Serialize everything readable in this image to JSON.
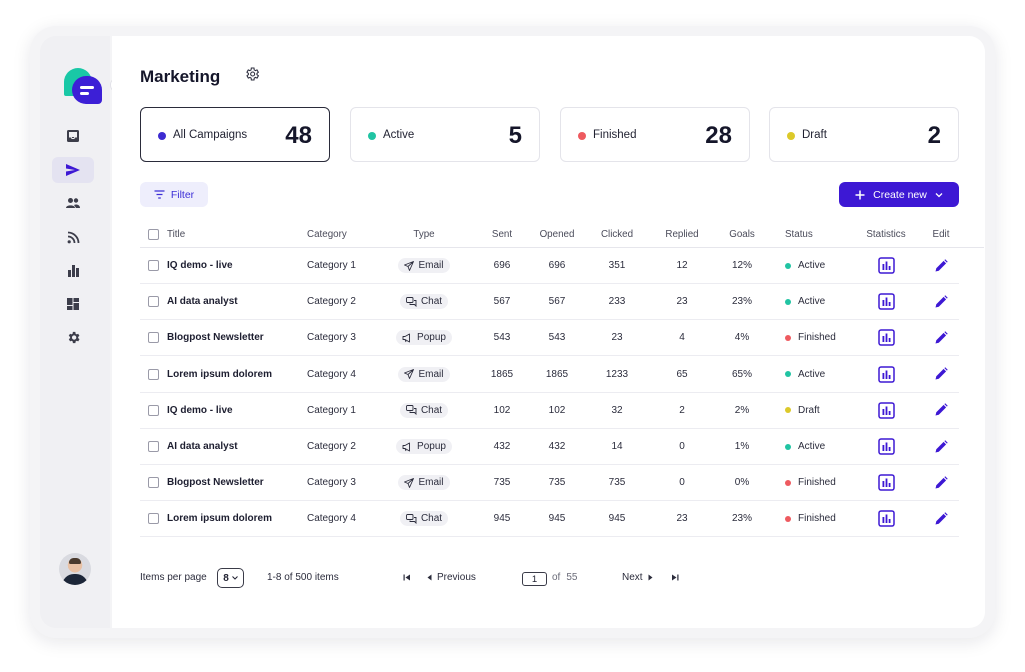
{
  "header": {
    "title": "Marketing"
  },
  "stats": [
    {
      "label": "All Campaigns",
      "count": "48",
      "color": "#3d2bd1"
    },
    {
      "label": "Active",
      "count": "5",
      "color": "#21c4a3"
    },
    {
      "label": "Finished",
      "count": "28",
      "color": "#ee5a5f"
    },
    {
      "label": "Draft",
      "count": "2",
      "color": "#dcc92a"
    }
  ],
  "toolbar": {
    "filter_label": "Filter",
    "create_label": "Create new"
  },
  "table": {
    "columns": [
      "Title",
      "Category",
      "Type",
      "Sent",
      "Opened",
      "Clicked",
      "Replied",
      "Goals",
      "Status",
      "Statistics",
      "Edit"
    ],
    "rows": [
      {
        "title": "IQ demo - live",
        "category": "Category 1",
        "type": "Email",
        "sent": "696",
        "opened": "696",
        "clicked": "351",
        "replied": "12",
        "goals": "12%",
        "status": "Active"
      },
      {
        "title": "AI data analyst",
        "category": "Category 2",
        "type": "Chat",
        "sent": "567",
        "opened": "567",
        "clicked": "233",
        "replied": "23",
        "goals": "23%",
        "status": "Active"
      },
      {
        "title": "Blogpost Newsletter",
        "category": "Category 3",
        "type": "Popup",
        "sent": "543",
        "opened": "543",
        "clicked": "23",
        "replied": "4",
        "goals": "4%",
        "status": "Finished"
      },
      {
        "title": "Lorem ipsum dolorem",
        "category": "Category 4",
        "type": "Email",
        "sent": "1865",
        "opened": "1865",
        "clicked": "1233",
        "replied": "65",
        "goals": "65%",
        "status": "Active"
      },
      {
        "title": "IQ demo - live",
        "category": "Category 1",
        "type": "Chat",
        "sent": "102",
        "opened": "102",
        "clicked": "32",
        "replied": "2",
        "goals": "2%",
        "status": "Draft"
      },
      {
        "title": "AI data analyst",
        "category": "Category 2",
        "type": "Popup",
        "sent": "432",
        "opened": "432",
        "clicked": "14",
        "replied": "0",
        "goals": "1%",
        "status": "Active"
      },
      {
        "title": "Blogpost Newsletter",
        "category": "Category 3",
        "type": "Email",
        "sent": "735",
        "opened": "735",
        "clicked": "735",
        "replied": "0",
        "goals": "0%",
        "status": "Finished"
      },
      {
        "title": "Lorem ipsum dolorem",
        "category": "Category 4",
        "type": "Chat",
        "sent": "945",
        "opened": "945",
        "clicked": "945",
        "replied": "23",
        "goals": "23%",
        "status": "Finished"
      }
    ]
  },
  "status_colors": {
    "Active": "#21c4a3",
    "Finished": "#ee5a5f",
    "Draft": "#dcc92a"
  },
  "type_icons": {
    "Email": "send-icon",
    "Chat": "chat-icon",
    "Popup": "popup-icon"
  },
  "pagination": {
    "items_per_page_label": "Items per page",
    "items_per_page_value": "8",
    "range_text": "1-8 of 500 items",
    "previous_label": "Previous",
    "next_label": "Next",
    "current_page": "1",
    "of_label": "of",
    "total_pages": "55"
  },
  "sidebar": {
    "items": [
      {
        "name": "inbox-icon",
        "active": false
      },
      {
        "name": "send-icon",
        "active": true
      },
      {
        "name": "users-icon",
        "active": false
      },
      {
        "name": "rss-icon",
        "active": false
      },
      {
        "name": "bar-chart-icon",
        "active": false
      },
      {
        "name": "dashboard-icon",
        "active": false
      },
      {
        "name": "gear-icon",
        "active": false
      }
    ]
  }
}
